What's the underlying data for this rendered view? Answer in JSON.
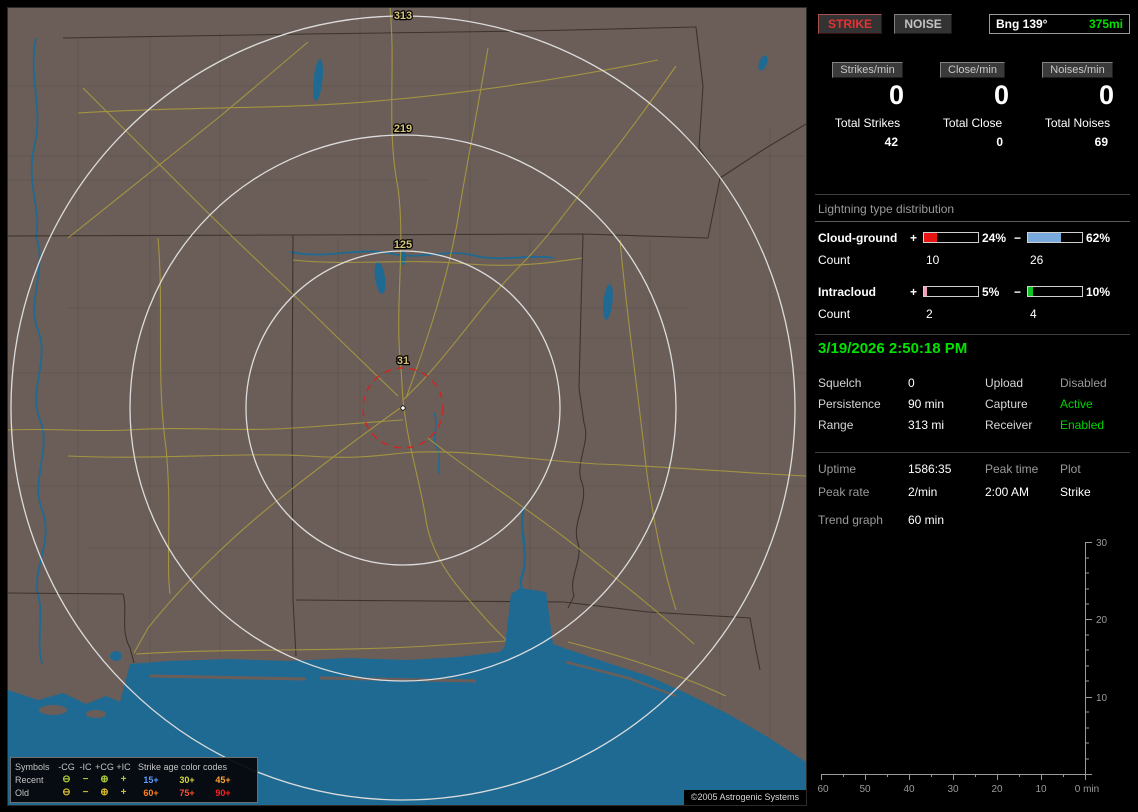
{
  "map": {
    "ring_labels": [
      "313",
      "219",
      "125",
      "31"
    ],
    "copyright": "©2005 Astrogenic Systems",
    "legend": {
      "symbols_header": "Symbols",
      "symbol_cols": [
        "-CG",
        "-IC",
        "+CG",
        "+IC"
      ],
      "age_header": "Strike age color codes",
      "rows": [
        {
          "label": "Recent",
          "symbols": [
            "⊖",
            "−",
            "⊕",
            "+"
          ],
          "symbol_color": "#a9c93a",
          "ages": [
            {
              "text": "15+",
              "color": "#5f9bff"
            },
            {
              "text": "30+",
              "color": "#d8d840"
            },
            {
              "text": "45+",
              "color": "#ffa030"
            }
          ]
        },
        {
          "label": "Old",
          "symbols": [
            "⊖",
            "−",
            "⊕",
            "+"
          ],
          "symbol_color": "#d2ba2a",
          "ages": [
            {
              "text": "60+",
              "color": "#ff8020"
            },
            {
              "text": "75+",
              "color": "#ff5030"
            },
            {
              "text": "90+",
              "color": "#ff2020"
            }
          ]
        }
      ]
    }
  },
  "panel": {
    "strike_button": "STRIKE",
    "noise_button": "NOISE",
    "bearing_label": "Bng 139°",
    "bearing_distance": "375mi",
    "counters": [
      {
        "badge": "Strikes/min",
        "rate": "0",
        "total_label": "Total Strikes",
        "total": "42"
      },
      {
        "badge": "Close/min",
        "rate": "0",
        "total_label": "Total Close",
        "total": "0"
      },
      {
        "badge": "Noises/min",
        "rate": "0",
        "total_label": "Total Noises",
        "total": "69"
      }
    ],
    "distribution": {
      "title": "Lightning type distribution",
      "count_label": "Count",
      "rows": [
        {
          "label": "Cloud-ground",
          "plus_sign": "+",
          "plus_pct": "24%",
          "plus_fill": 24,
          "plus_color": "#e81414",
          "plus_count": "10",
          "minus_sign": "−",
          "minus_pct": "62%",
          "minus_fill": 62,
          "minus_color": "#78aade",
          "minus_count": "26"
        },
        {
          "label": "Intracloud",
          "plus_sign": "+",
          "plus_pct": "5%",
          "plus_fill": 5,
          "plus_color": "#f0a0b8",
          "plus_count": "2",
          "minus_sign": "−",
          "minus_pct": "10%",
          "minus_fill": 10,
          "minus_color": "#10c424",
          "minus_count": "4"
        }
      ]
    },
    "timestamp": "3/19/2026 2:50:18 PM",
    "settings": {
      "rows": [
        {
          "l1": "Squelch",
          "v1": "0",
          "l2": "Upload",
          "v2": "Disabled",
          "v2_color": "#9a9a9a"
        },
        {
          "l1": "Persistence",
          "v1": "90 min",
          "l2": "Capture",
          "v2": "Active",
          "v2_color": "#00d400"
        },
        {
          "l1": "Range",
          "v1": "313 mi",
          "l2": "Receiver",
          "v2": "Enabled",
          "v2_color": "#00d400"
        }
      ]
    },
    "stats": {
      "uptime_label": "Uptime",
      "uptime_value": "1586:35",
      "peak_time_label": "Peak time",
      "peak_time_value": "2:00 AM",
      "plot_label": "Plot",
      "plot_value": "Strike",
      "peak_rate_label": "Peak rate",
      "peak_rate_value": "2/min",
      "trend_label": "Trend graph",
      "trend_value": "60 min"
    },
    "trend_graph": {
      "y_ticks": [
        "30",
        "20",
        "10"
      ],
      "x_ticks": [
        "60",
        "50",
        "40",
        "30",
        "20",
        "10",
        "0 min"
      ]
    }
  }
}
